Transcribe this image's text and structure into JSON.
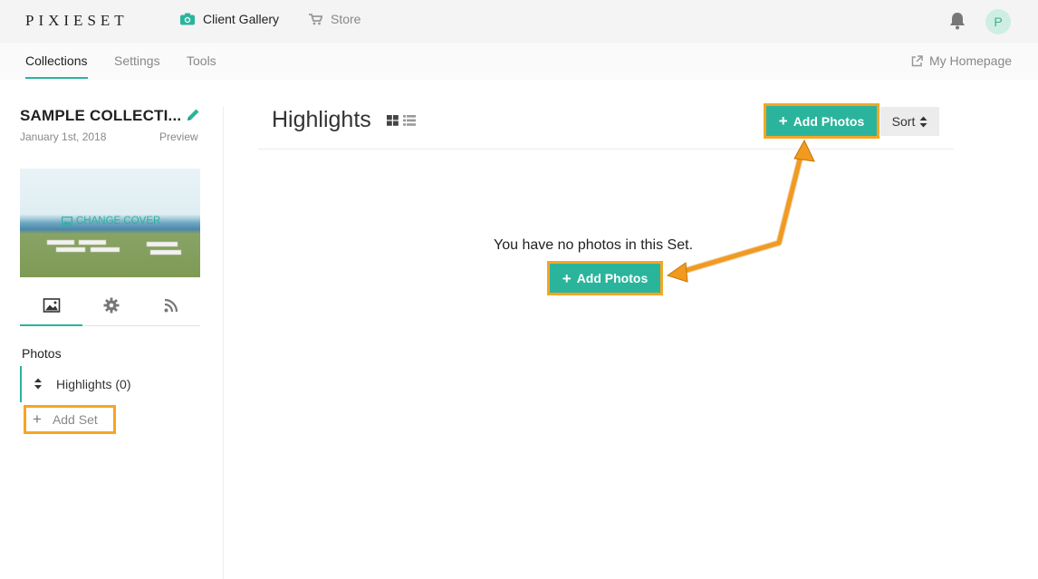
{
  "app": {
    "logo": "PIXIESET",
    "nav": [
      {
        "label": "Client Gallery"
      },
      {
        "label": "Store"
      }
    ],
    "avatar_initial": "P"
  },
  "subnav": {
    "tabs": [
      {
        "label": "Collections",
        "active": true
      },
      {
        "label": "Settings",
        "active": false
      },
      {
        "label": "Tools",
        "active": false
      }
    ],
    "homepage_label": "My Homepage"
  },
  "sidebar": {
    "collection_title": "SAMPLE COLLECTI...",
    "collection_date": "January 1st, 2018",
    "preview_label": "Preview",
    "change_cover_label": "CHANGE COVER",
    "tabs": [
      "photos-icon",
      "gear-icon",
      "rss-icon"
    ],
    "photos_heading": "Photos",
    "sets": [
      {
        "label": "Highlights (0)"
      }
    ],
    "add_set_label": "Add Set"
  },
  "main": {
    "title": "Highlights",
    "add_photos_label": "Add Photos",
    "sort_label": "Sort",
    "empty_message": "You have no photos in this Set.",
    "empty_add_photos_label": "Add Photos"
  },
  "colors": {
    "accent": "#2bb49c",
    "highlight": "#f5a623",
    "arrow": "#f29a1f"
  }
}
